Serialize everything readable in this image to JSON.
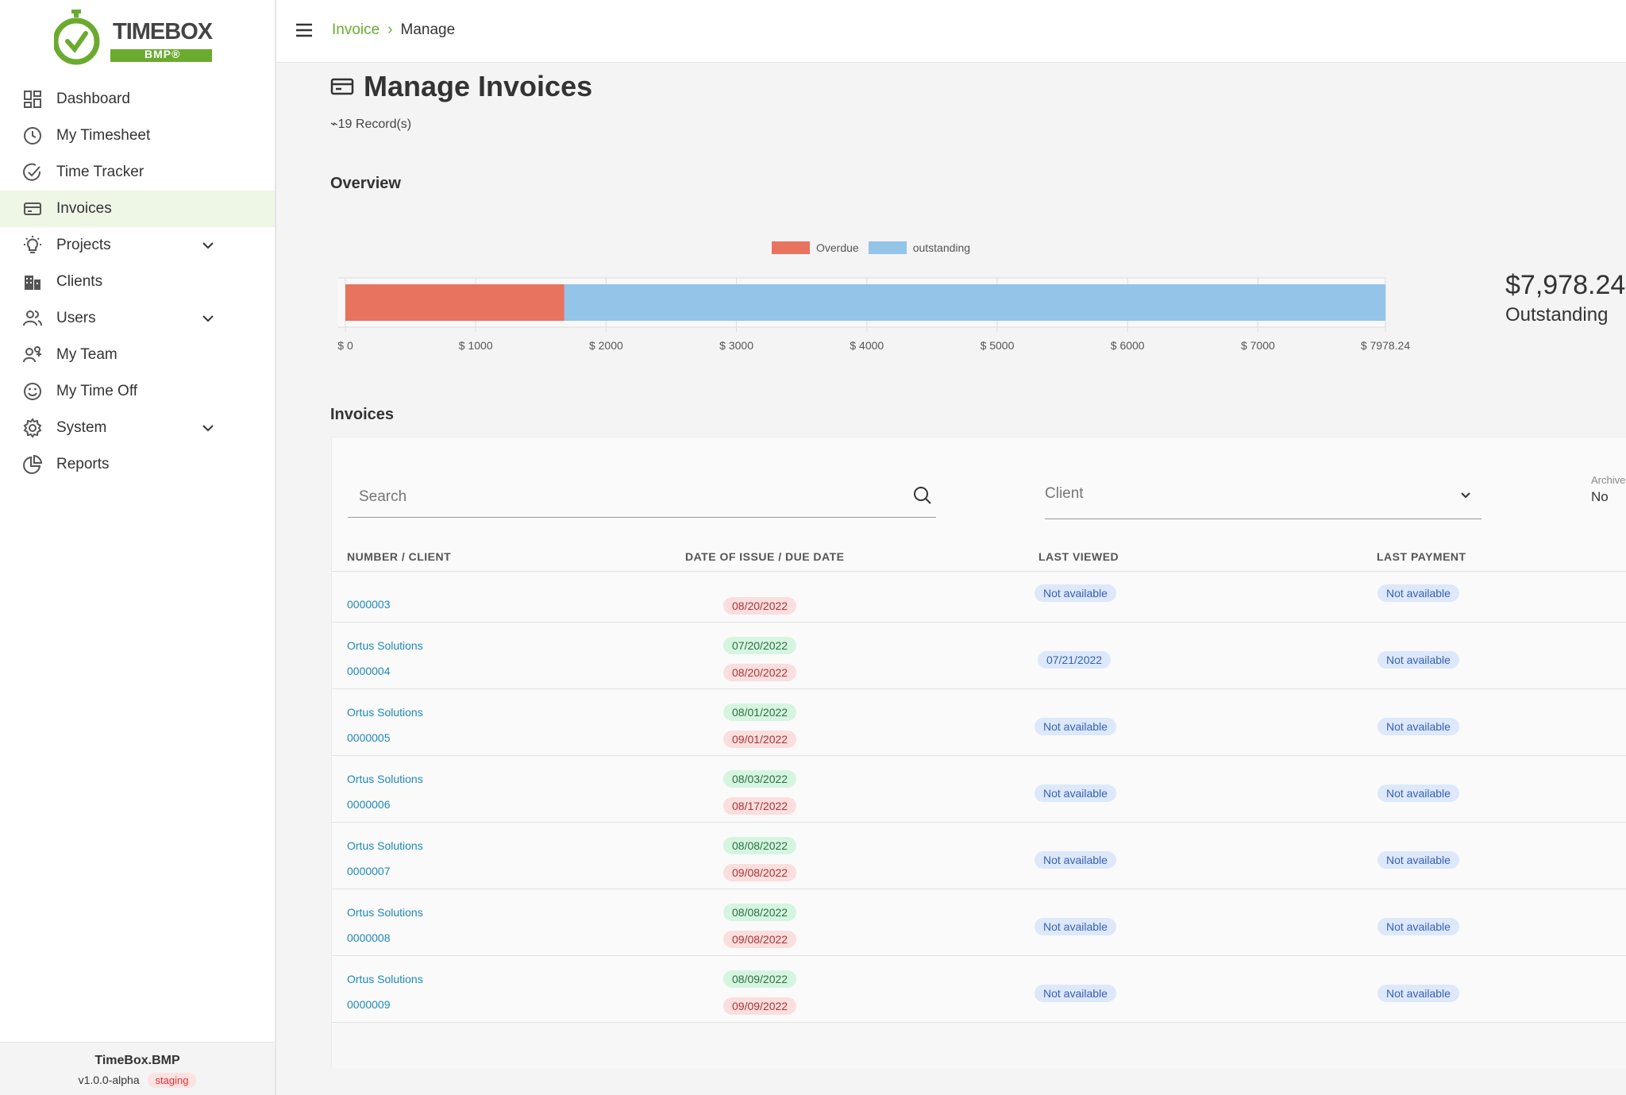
{
  "logo": {
    "brand": "TIMEBOX",
    "sub": "BMP®"
  },
  "sidebar": {
    "items": [
      {
        "label": "Dashboard",
        "icon": "dashboard-icon"
      },
      {
        "label": "My Timesheet",
        "icon": "clock-icon"
      },
      {
        "label": "Time Tracker",
        "icon": "check-circle-icon"
      },
      {
        "label": "Invoices",
        "icon": "invoice-icon",
        "active": true
      },
      {
        "label": "Projects",
        "icon": "lightbulb-icon",
        "expandable": true
      },
      {
        "label": "Clients",
        "icon": "building-icon"
      },
      {
        "label": "Users",
        "icon": "users-icon",
        "expandable": true
      },
      {
        "label": "My Team",
        "icon": "team-icon"
      },
      {
        "label": "My Time Off",
        "icon": "smile-icon"
      },
      {
        "label": "System",
        "icon": "gear-icon",
        "expandable": true
      },
      {
        "label": "Reports",
        "icon": "pie-chart-icon"
      }
    ],
    "footer": {
      "brand": "TimeBox.BMP",
      "version": "v1.0.0-alpha",
      "env": "staging"
    }
  },
  "breadcrumb": {
    "parent": "Invoice",
    "current": "Manage"
  },
  "page": {
    "title": "Manage Invoices",
    "records": "19 Record(s)"
  },
  "overview": {
    "heading": "Overview"
  },
  "chart_data": {
    "type": "bar",
    "orientation": "horizontal-stacked",
    "series": [
      {
        "name": "Overdue",
        "values": [
          1680
        ],
        "color": "#e8735f"
      },
      {
        "name": "outstanding",
        "values": [
          6298.24
        ],
        "color": "#94c4e8"
      }
    ],
    "xlim": [
      0,
      7978.24
    ],
    "ticks": [
      "$ 0",
      "$ 1000",
      "$ 2000",
      "$ 3000",
      "$ 4000",
      "$ 5000",
      "$ 6000",
      "$ 7000",
      "$ 7978.24"
    ],
    "tick_values": [
      0,
      1000,
      2000,
      3000,
      4000,
      5000,
      6000,
      7000,
      7978.24
    ],
    "legend": "top-center",
    "grid": true
  },
  "summary": {
    "amount": "$7,978.24",
    "label": "Outstanding"
  },
  "invoices": {
    "heading": "Invoices",
    "search_placeholder": "Search",
    "client_placeholder": "Client",
    "archive_label": "Archive",
    "archive_value": "No",
    "columns": [
      "NUMBER / CLIENT",
      "DATE OF ISSUE / DUE DATE",
      "LAST VIEWED",
      "LAST PAYMENT"
    ],
    "rows": [
      {
        "client": "",
        "number": "0000003",
        "issue": "",
        "due": "08/20/2022",
        "viewed": "Not available",
        "payment": "Not available"
      },
      {
        "client": "Ortus Solutions",
        "number": "0000004",
        "issue": "07/20/2022",
        "due": "08/20/2022",
        "viewed": "07/21/2022",
        "payment": "Not available"
      },
      {
        "client": "Ortus Solutions",
        "number": "0000005",
        "issue": "08/01/2022",
        "due": "09/01/2022",
        "viewed": "Not available",
        "payment": "Not available"
      },
      {
        "client": "Ortus Solutions",
        "number": "0000006",
        "issue": "08/03/2022",
        "due": "08/17/2022",
        "viewed": "Not available",
        "payment": "Not available"
      },
      {
        "client": "Ortus Solutions",
        "number": "0000007",
        "issue": "08/08/2022",
        "due": "09/08/2022",
        "viewed": "Not available",
        "payment": "Not available"
      },
      {
        "client": "Ortus Solutions",
        "number": "0000008",
        "issue": "08/08/2022",
        "due": "09/08/2022",
        "viewed": "Not available",
        "payment": "Not available"
      },
      {
        "client": "Ortus Solutions",
        "number": "0000009",
        "issue": "08/09/2022",
        "due": "09/09/2022",
        "viewed": "Not available",
        "payment": "Not available"
      }
    ]
  }
}
